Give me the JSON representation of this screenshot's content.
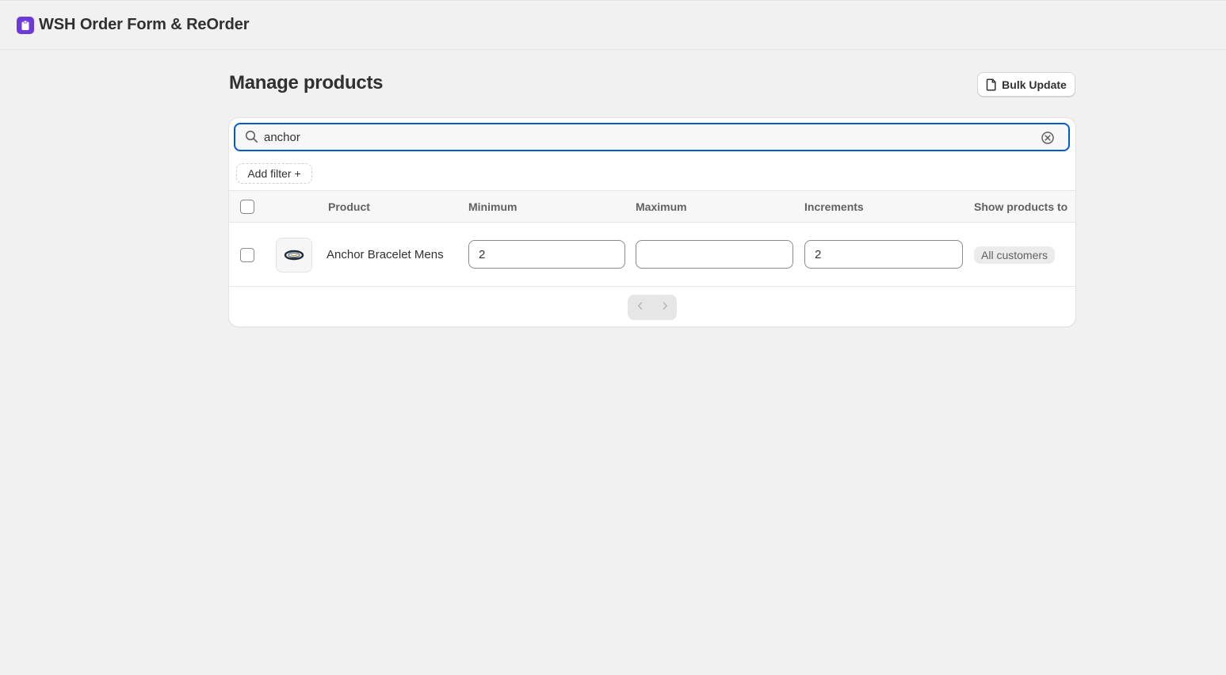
{
  "app": {
    "title": "WSH Order Form & ReOrder",
    "brand_color": "#6c3ad6"
  },
  "page": {
    "title": "Manage products",
    "bulk_update_label": "Bulk Update"
  },
  "search": {
    "value": "anchor",
    "focus_color": "#005bd3"
  },
  "filters": {
    "add_filter_label": "Add filter +"
  },
  "table": {
    "columns": [
      "Product",
      "Minimum",
      "Maximum",
      "Increments",
      "Show products to"
    ],
    "rows": [
      {
        "product": "Anchor Bracelet Mens",
        "image_icon": "bracelet-thumbnail",
        "minimum": "2",
        "maximum": "",
        "increments": "2",
        "show_to": "All customers"
      }
    ]
  },
  "pagination": {
    "prev_icon": "chevron-left-icon",
    "next_icon": "chevron-right-icon"
  }
}
